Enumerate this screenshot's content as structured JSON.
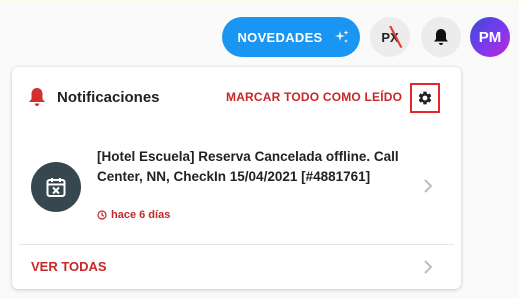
{
  "topbar": {
    "novedades_label": "NOVEDADES",
    "px_label": "PX",
    "avatar_initials": "PM"
  },
  "panel": {
    "title": "Notificaciones",
    "mark_all_label": "MARCAR TODO COMO LEÍDO",
    "notifications": [
      {
        "text": "[Hotel Escuela] Reserva Cancelada offline. Call Center, NN, CheckIn 15/04/2021 [#4881761]",
        "time": "hace 6 días"
      }
    ],
    "view_all_label": "VER TODAS"
  },
  "colors": {
    "accent_blue": "#1a95f2",
    "accent_red": "#c62828",
    "icon_dark": "#37474f"
  }
}
